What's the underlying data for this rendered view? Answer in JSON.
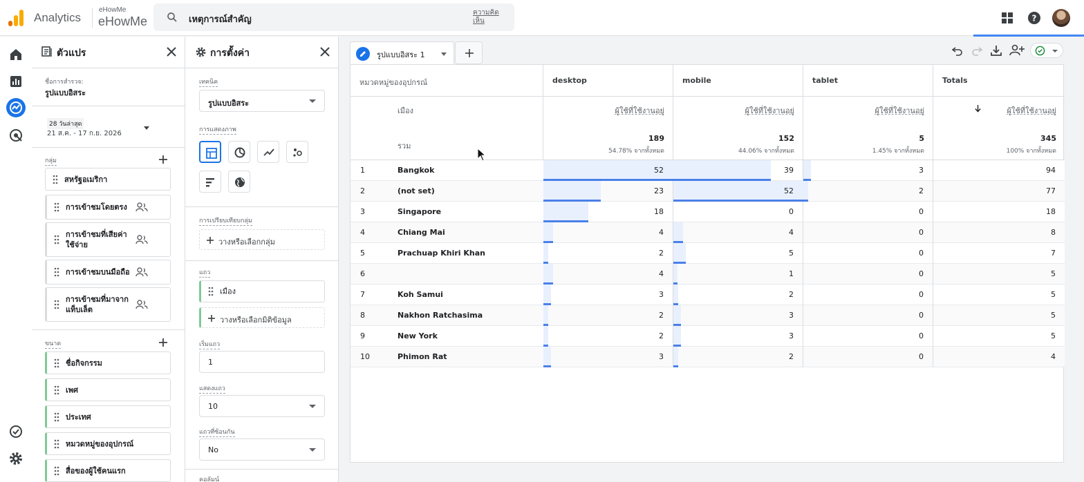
{
  "header": {
    "app_name": "Analytics",
    "account_small": "eHowMe",
    "account_big": "eHowMe",
    "search_value": "เหตุการณ์สำคัญ",
    "search_feedback": "ความคิดเห็น",
    "icons": [
      "apps-icon",
      "help-icon",
      "avatar"
    ]
  },
  "variables_panel": {
    "title": "ตัวแปร",
    "exploration_label": "ชื่อการสำรวจ:",
    "exploration_name": "รูปแบบอิสระ",
    "date_badge": "28 วันล่าสุด",
    "date_range": "21 ส.ค. - 17 ก.ย. 2026",
    "segments_label": "กลุ่ม",
    "segments": [
      {
        "label": "สหรัฐอเมริกา"
      },
      {
        "label": "การเข้าชมโดยตรง"
      },
      {
        "label": "การเข้าชมที่เสียค่าใช้จ่าย"
      },
      {
        "label": "การเข้าชมบนมือถือ"
      },
      {
        "label": "การเข้าชมที่มาจากแท็บเล็ต"
      }
    ],
    "dimensions_label": "ขนาด",
    "dimensions": [
      {
        "label": "ชื่อกิจกรรม"
      },
      {
        "label": "เพศ"
      },
      {
        "label": "ประเทศ"
      },
      {
        "label": "หมวดหมู่ของอุปกรณ์"
      },
      {
        "label": "สื่อของผู้ใช้คนแรก"
      }
    ]
  },
  "settings_panel": {
    "title": "การตั้งค่า",
    "technique_label": "เทคนิค",
    "technique_value": "รูปแบบอิสระ",
    "visualization_label": "การแสดงภาพ",
    "segment_compare_label": "การเปรียบเทียบกลุ่ม",
    "segment_drop": "วางหรือเลือกกลุ่ม",
    "rows_label": "แถว",
    "row_dimension": "เมือง",
    "row_drop": "วางหรือเลือกมิติข้อมูล",
    "start_row_label": "เริ่มแถว",
    "start_row_value": "1",
    "show_rows_label": "แสดงแถว",
    "show_rows_value": "10",
    "nested_rows_label": "แถวที่ซ้อนกัน",
    "nested_rows_value": "No",
    "columns_label": "คอลัมน์"
  },
  "canvas": {
    "tab_label": "รูปแบบอิสระ 1"
  },
  "table": {
    "col_dimension": "หมวดหมู่ของอุปกรณ์",
    "row_dimension": "เมือง",
    "totals_label": "รวม",
    "metric": "ผู้ใช้ที่ใช้งานอยู่",
    "columns": [
      {
        "name": "desktop",
        "total": "189",
        "pct": "54.78% จากทั้งหมด"
      },
      {
        "name": "mobile",
        "total": "152",
        "pct": "44.06% จากทั้งหมด"
      },
      {
        "name": "tablet",
        "total": "5",
        "pct": "1.45% จากทั้งหมด"
      },
      {
        "name": "Totals",
        "total": "345",
        "pct": "100% จากทั้งหมด"
      }
    ],
    "rows": [
      {
        "idx": "1",
        "city": "Bangkok",
        "desktop": 52,
        "mobile": 39,
        "tablet": 3,
        "total": 94
      },
      {
        "idx": "2",
        "city": "(not set)",
        "desktop": 23,
        "mobile": 52,
        "tablet": 2,
        "total": 77
      },
      {
        "idx": "3",
        "city": "Singapore",
        "desktop": 18,
        "mobile": 0,
        "tablet": 0,
        "total": 18
      },
      {
        "idx": "4",
        "city": "Chiang Mai",
        "desktop": 4,
        "mobile": 4,
        "tablet": 0,
        "total": 8
      },
      {
        "idx": "5",
        "city": "Prachuap Khiri Khan",
        "desktop": 2,
        "mobile": 5,
        "tablet": 0,
        "total": 7
      },
      {
        "idx": "6",
        "city": "",
        "desktop": 4,
        "mobile": 1,
        "tablet": 0,
        "total": 5
      },
      {
        "idx": "7",
        "city": "Koh Samui",
        "desktop": 3,
        "mobile": 2,
        "tablet": 0,
        "total": 5
      },
      {
        "idx": "8",
        "city": "Nakhon Ratchasima",
        "desktop": 2,
        "mobile": 3,
        "tablet": 0,
        "total": 5
      },
      {
        "idx": "9",
        "city": "New York",
        "desktop": 2,
        "mobile": 3,
        "tablet": 0,
        "total": 5
      },
      {
        "idx": "10",
        "city": "Phimon Rat",
        "desktop": 3,
        "mobile": 2,
        "tablet": 0,
        "total": 4
      }
    ]
  },
  "colors": {
    "accent": "#1a73e8",
    "bar_fill": "#e8f0fe",
    "bar_line": "#4a80e8",
    "dimension_green": "#81c995",
    "logo_orange": "#f9ab00",
    "logo_dark_orange": "#e37400"
  }
}
